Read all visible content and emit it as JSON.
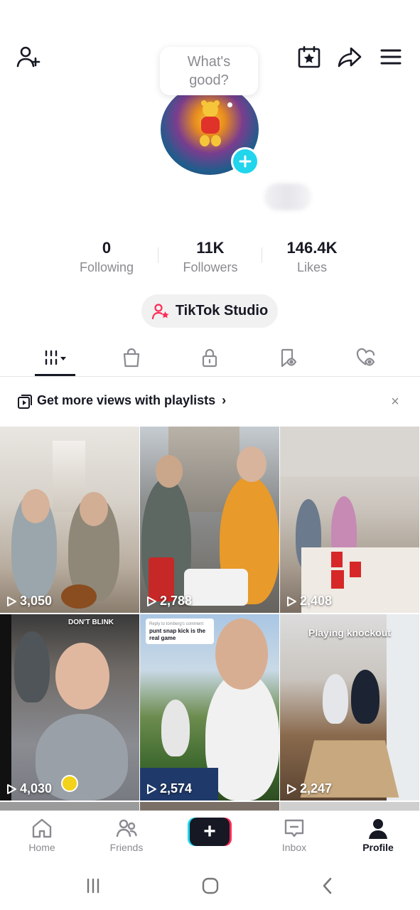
{
  "header": {
    "bubble_text": "What's good?",
    "icons": [
      "add-friend-icon",
      "calendar-star-icon",
      "share-icon",
      "menu-icon"
    ]
  },
  "profile": {
    "avatar_icon": "avatar",
    "add_icon": "plus-icon"
  },
  "stats": [
    {
      "value": "0",
      "label": "Following"
    },
    {
      "value": "11K",
      "label": "Followers"
    },
    {
      "value": "146.4K",
      "label": "Likes"
    }
  ],
  "studio": {
    "label": "TikTok Studio",
    "icon": "person-star-icon",
    "accent": "#fe2c55"
  },
  "tabs": {
    "items": [
      "videos-grid-icon",
      "shop-bag-icon",
      "lock-icon",
      "saved-icon",
      "liked-icon"
    ],
    "active_index": 0
  },
  "playlist_banner": {
    "text": "Get more views with playlists",
    "chevron": "›",
    "close": "×"
  },
  "videos": [
    {
      "views": "3,050"
    },
    {
      "views": "2,788"
    },
    {
      "views": "2,408"
    },
    {
      "views": "4,030",
      "caption": "DON'T BLINK"
    },
    {
      "views": "2,574",
      "reply_title": "Reply to tomberg's comment",
      "reply_text": "punt snap kick is the real game"
    },
    {
      "views": "2,247",
      "caption": "Playing knockout"
    }
  ],
  "bottom_nav": [
    {
      "label": "Home",
      "icon": "home-icon"
    },
    {
      "label": "Friends",
      "icon": "friends-icon"
    },
    {
      "label": "+",
      "icon": "create-icon"
    },
    {
      "label": "Inbox",
      "icon": "inbox-icon"
    },
    {
      "label": "Profile",
      "icon": "profile-icon",
      "active": true
    }
  ],
  "colors": {
    "cyan": "#20d5ec",
    "red": "#fe2c55",
    "text": "#161823",
    "muted": "#8a8b91"
  }
}
